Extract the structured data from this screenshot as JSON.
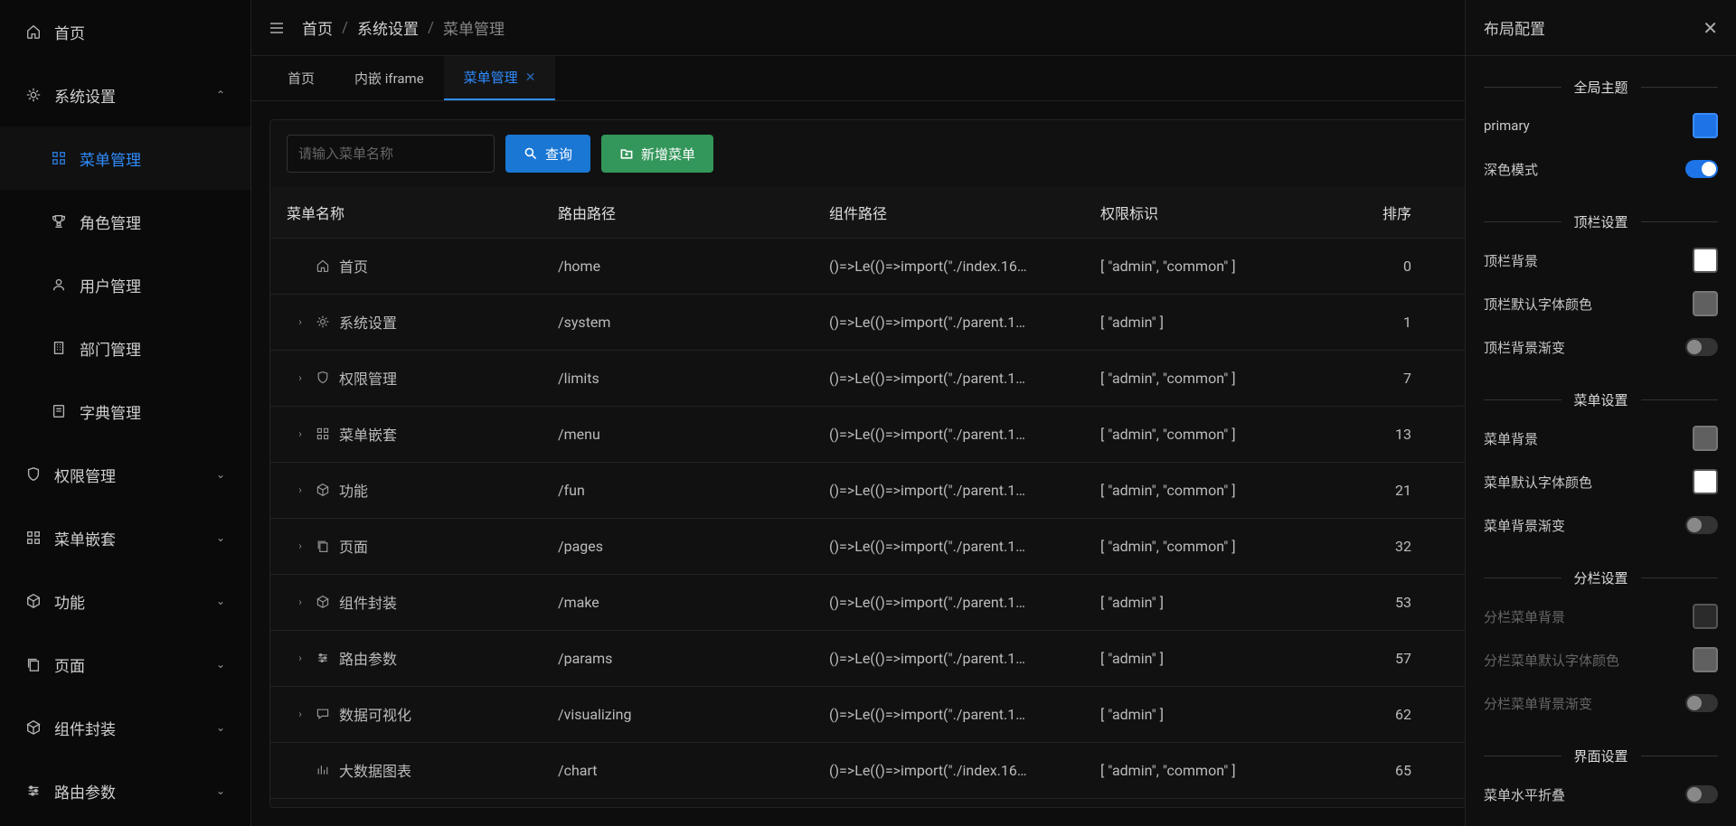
{
  "sidebar": {
    "items": [
      {
        "label": "首页",
        "icon": "house",
        "level": 0
      },
      {
        "label": "系统设置",
        "icon": "gear",
        "level": 0,
        "expand": "up"
      },
      {
        "label": "菜单管理",
        "icon": "grid",
        "level": 1,
        "active": true
      },
      {
        "label": "角色管理",
        "icon": "trophy",
        "level": 1
      },
      {
        "label": "用户管理",
        "icon": "user",
        "level": 1
      },
      {
        "label": "部门管理",
        "icon": "building",
        "level": 1
      },
      {
        "label": "字典管理",
        "icon": "book",
        "level": 1
      },
      {
        "label": "权限管理",
        "icon": "shield",
        "level": 0,
        "expand": "down"
      },
      {
        "label": "菜单嵌套",
        "icon": "grid",
        "level": 0,
        "expand": "down"
      },
      {
        "label": "功能",
        "icon": "cube",
        "level": 0,
        "expand": "down"
      },
      {
        "label": "页面",
        "icon": "copy",
        "level": 0,
        "expand": "down"
      },
      {
        "label": "组件封装",
        "icon": "package",
        "level": 0,
        "expand": "down"
      },
      {
        "label": "路由参数",
        "icon": "sliders",
        "level": 0,
        "expand": "down"
      }
    ]
  },
  "breadcrumb": [
    "首页",
    "系统设置",
    "菜单管理"
  ],
  "tabs": [
    {
      "label": "首页",
      "active": false,
      "closable": false
    },
    {
      "label": "内嵌 iframe",
      "active": false,
      "closable": false
    },
    {
      "label": "菜单管理",
      "active": true,
      "closable": true
    }
  ],
  "toolbar": {
    "search_placeholder": "请输入菜单名称",
    "search_btn": "查询",
    "add_btn": "新增菜单"
  },
  "table": {
    "columns": [
      "菜单名称",
      "路由路径",
      "组件路径",
      "权限标识",
      "排序"
    ],
    "rows": [
      {
        "expand": "",
        "icon": "house",
        "name": "首页",
        "route": "/home",
        "comp": "()=>Le(()=>import(\"./index.16…",
        "auth": "[ \"admin\", \"common\" ]",
        "sort": "0"
      },
      {
        "expand": "›",
        "icon": "gear",
        "name": "系统设置",
        "route": "/system",
        "comp": "()=>Le(()=>import(\"./parent.1…",
        "auth": "[ \"admin\" ]",
        "sort": "1"
      },
      {
        "expand": "›",
        "icon": "shield",
        "name": "权限管理",
        "route": "/limits",
        "comp": "()=>Le(()=>import(\"./parent.1…",
        "auth": "[ \"admin\", \"common\" ]",
        "sort": "7"
      },
      {
        "expand": "›",
        "icon": "grid",
        "name": "菜单嵌套",
        "route": "/menu",
        "comp": "()=>Le(()=>import(\"./parent.1…",
        "auth": "[ \"admin\", \"common\" ]",
        "sort": "13"
      },
      {
        "expand": "›",
        "icon": "cube",
        "name": "功能",
        "route": "/fun",
        "comp": "()=>Le(()=>import(\"./parent.1…",
        "auth": "[ \"admin\", \"common\" ]",
        "sort": "21"
      },
      {
        "expand": "›",
        "icon": "copy",
        "name": "页面",
        "route": "/pages",
        "comp": "()=>Le(()=>import(\"./parent.1…",
        "auth": "[ \"admin\", \"common\" ]",
        "sort": "32"
      },
      {
        "expand": "›",
        "icon": "package",
        "name": "组件封装",
        "route": "/make",
        "comp": "()=>Le(()=>import(\"./parent.1…",
        "auth": "[ \"admin\" ]",
        "sort": "53"
      },
      {
        "expand": "›",
        "icon": "sliders",
        "name": "路由参数",
        "route": "/params",
        "comp": "()=>Le(()=>import(\"./parent.1…",
        "auth": "[ \"admin\" ]",
        "sort": "57"
      },
      {
        "expand": "›",
        "icon": "chat",
        "name": "数据可视化",
        "route": "/visualizing",
        "comp": "()=>Le(()=>import(\"./parent.1…",
        "auth": "[ \"admin\" ]",
        "sort": "62"
      },
      {
        "expand": "",
        "icon": "bars",
        "name": "大数据图表",
        "route": "/chart",
        "comp": "()=>Le(()=>import(\"./index.16…",
        "auth": "[ \"admin\", \"common\" ]",
        "sort": "65"
      }
    ]
  },
  "drawer": {
    "title": "布局配置",
    "sections": {
      "global": {
        "title": "全局主题",
        "primary_label": "primary",
        "dark_label": "深色模式"
      },
      "topcol": {
        "title": "顶栏设置",
        "bg": "顶栏背景",
        "font": "顶栏默认字体颜色",
        "grad": "顶栏背景渐变"
      },
      "menu": {
        "title": "菜单设置",
        "bg": "菜单背景",
        "font": "菜单默认字体颜色",
        "grad": "菜单背景渐变"
      },
      "column": {
        "title": "分栏设置",
        "bg": "分栏菜单背景",
        "font": "分栏菜单默认字体颜色",
        "grad": "分栏菜单背景渐变"
      },
      "ui": {
        "title": "界面设置",
        "hcollapse": "菜单水平折叠"
      }
    }
  }
}
